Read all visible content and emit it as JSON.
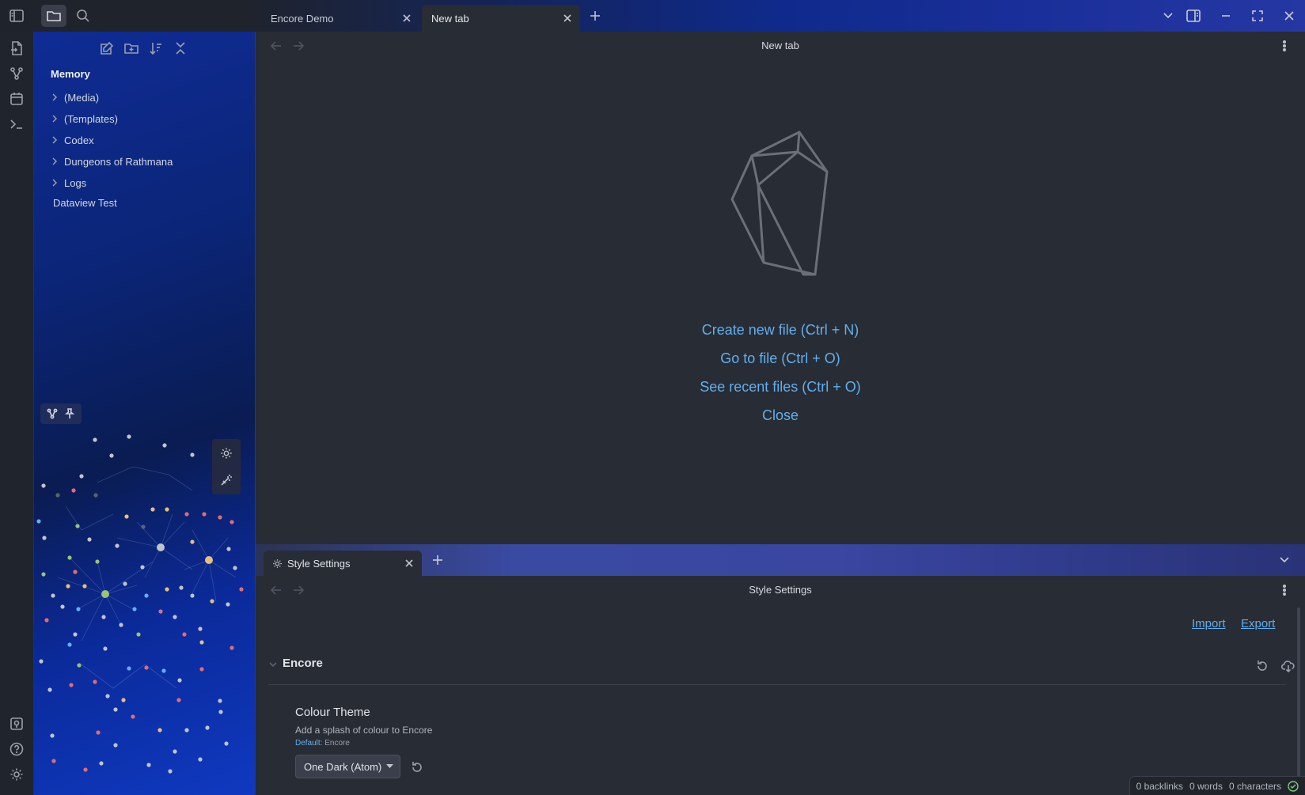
{
  "window": {
    "tabs": [
      {
        "label": "Encore Demo",
        "active": false
      },
      {
        "label": "New tab",
        "active": true
      }
    ]
  },
  "sidebar": {
    "vault_name": "Memory",
    "items": [
      {
        "label": "(Media)",
        "type": "folder"
      },
      {
        "label": "(Templates)",
        "type": "folder"
      },
      {
        "label": "Codex",
        "type": "folder"
      },
      {
        "label": "Dungeons of Rathmana",
        "type": "folder"
      },
      {
        "label": "Logs",
        "type": "folder"
      },
      {
        "label": "Dataview Test",
        "type": "file"
      }
    ]
  },
  "main": {
    "header_title": "New tab",
    "actions": [
      "Create new file (Ctrl + N)",
      "Go to file (Ctrl + O)",
      "See recent files (Ctrl + O)",
      "Close"
    ]
  },
  "bottom": {
    "tab_label": "Style Settings",
    "header_title": "Style Settings",
    "import_label": "Import",
    "export_label": "Export",
    "section_title": "Encore",
    "setting": {
      "title": "Colour Theme",
      "description": "Add a splash of colour to Encore",
      "default_label": "Default:",
      "default_value": "Encore",
      "selected": "One Dark (Atom)"
    }
  },
  "status": {
    "backlinks": "0 backlinks",
    "words": "0 words",
    "characters": "0 characters"
  },
  "colors": {
    "accent_link": "#61afef",
    "background": "#282c34",
    "status_ok": "#7ec97e"
  }
}
